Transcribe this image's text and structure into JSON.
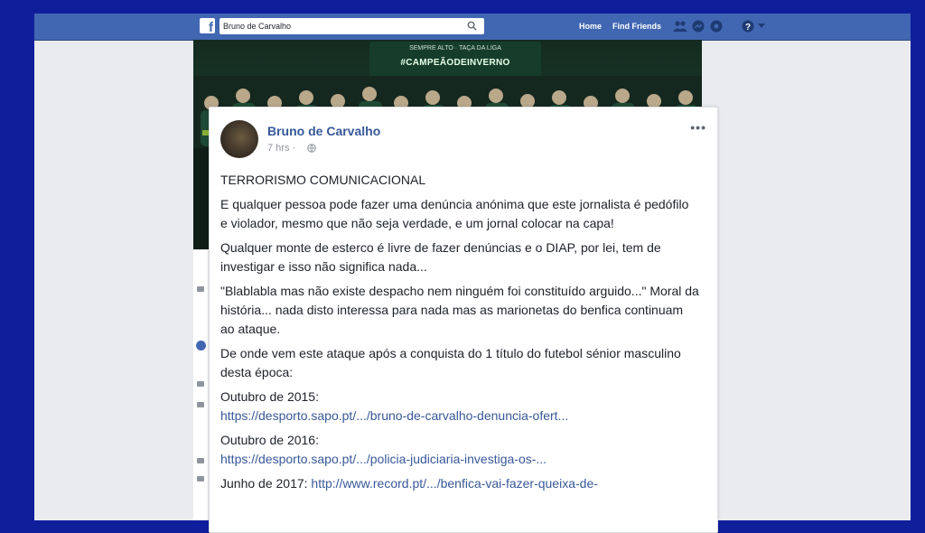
{
  "topbar": {
    "logo": "f",
    "search_value": "Bruno de Carvalho",
    "nav": [
      "Home",
      "Find Friends"
    ]
  },
  "cover": {
    "banner_small": "SEMPRE ALTO · TAÇA DA LIGA",
    "banner_text": "#CAMPEÃODEINVERNO"
  },
  "post": {
    "author": "Bruno de Carvalho",
    "time": "7 hrs ·",
    "title_line": "TERRORISMO COMUNICACIONAL",
    "paragraphs": [
      "E qualquer pessoa pode fazer uma denúncia anónima que este jornalista é pedófilo e violador, mesmo que não seja verdade, e um jornal colocar na capa!",
      "Qualquer monte de esterco é livre de fazer denúncias e o DIAP, por lei, tem de investigar e isso não significa nada...",
      "\"Blablabla mas não existe despacho nem ninguém foi constituído arguido...\" Moral da história... nada disto interessa para nada mas as marionetas do benfica continuam ao ataque.",
      "De onde vem este ataque após a conquista do 1 título do futebol sénior masculino desta época:"
    ],
    "items": [
      {
        "label": "Outubro de 2015:",
        "link": "https://desporto.sapo.pt/.../bruno-de-carvalho-denuncia-ofert..."
      },
      {
        "label": "Outubro de 2016:",
        "link": "https://desporto.sapo.pt/.../policia-judiciaria-investiga-os-..."
      },
      {
        "label": "Junho de 2017:",
        "link": "http://www.record.pt/.../benfica-vai-fazer-queixa-de-"
      }
    ]
  },
  "colors": {
    "facebook_blue": "#4267b2",
    "link_blue": "#385898",
    "outer_background": "#0f1f9c"
  }
}
